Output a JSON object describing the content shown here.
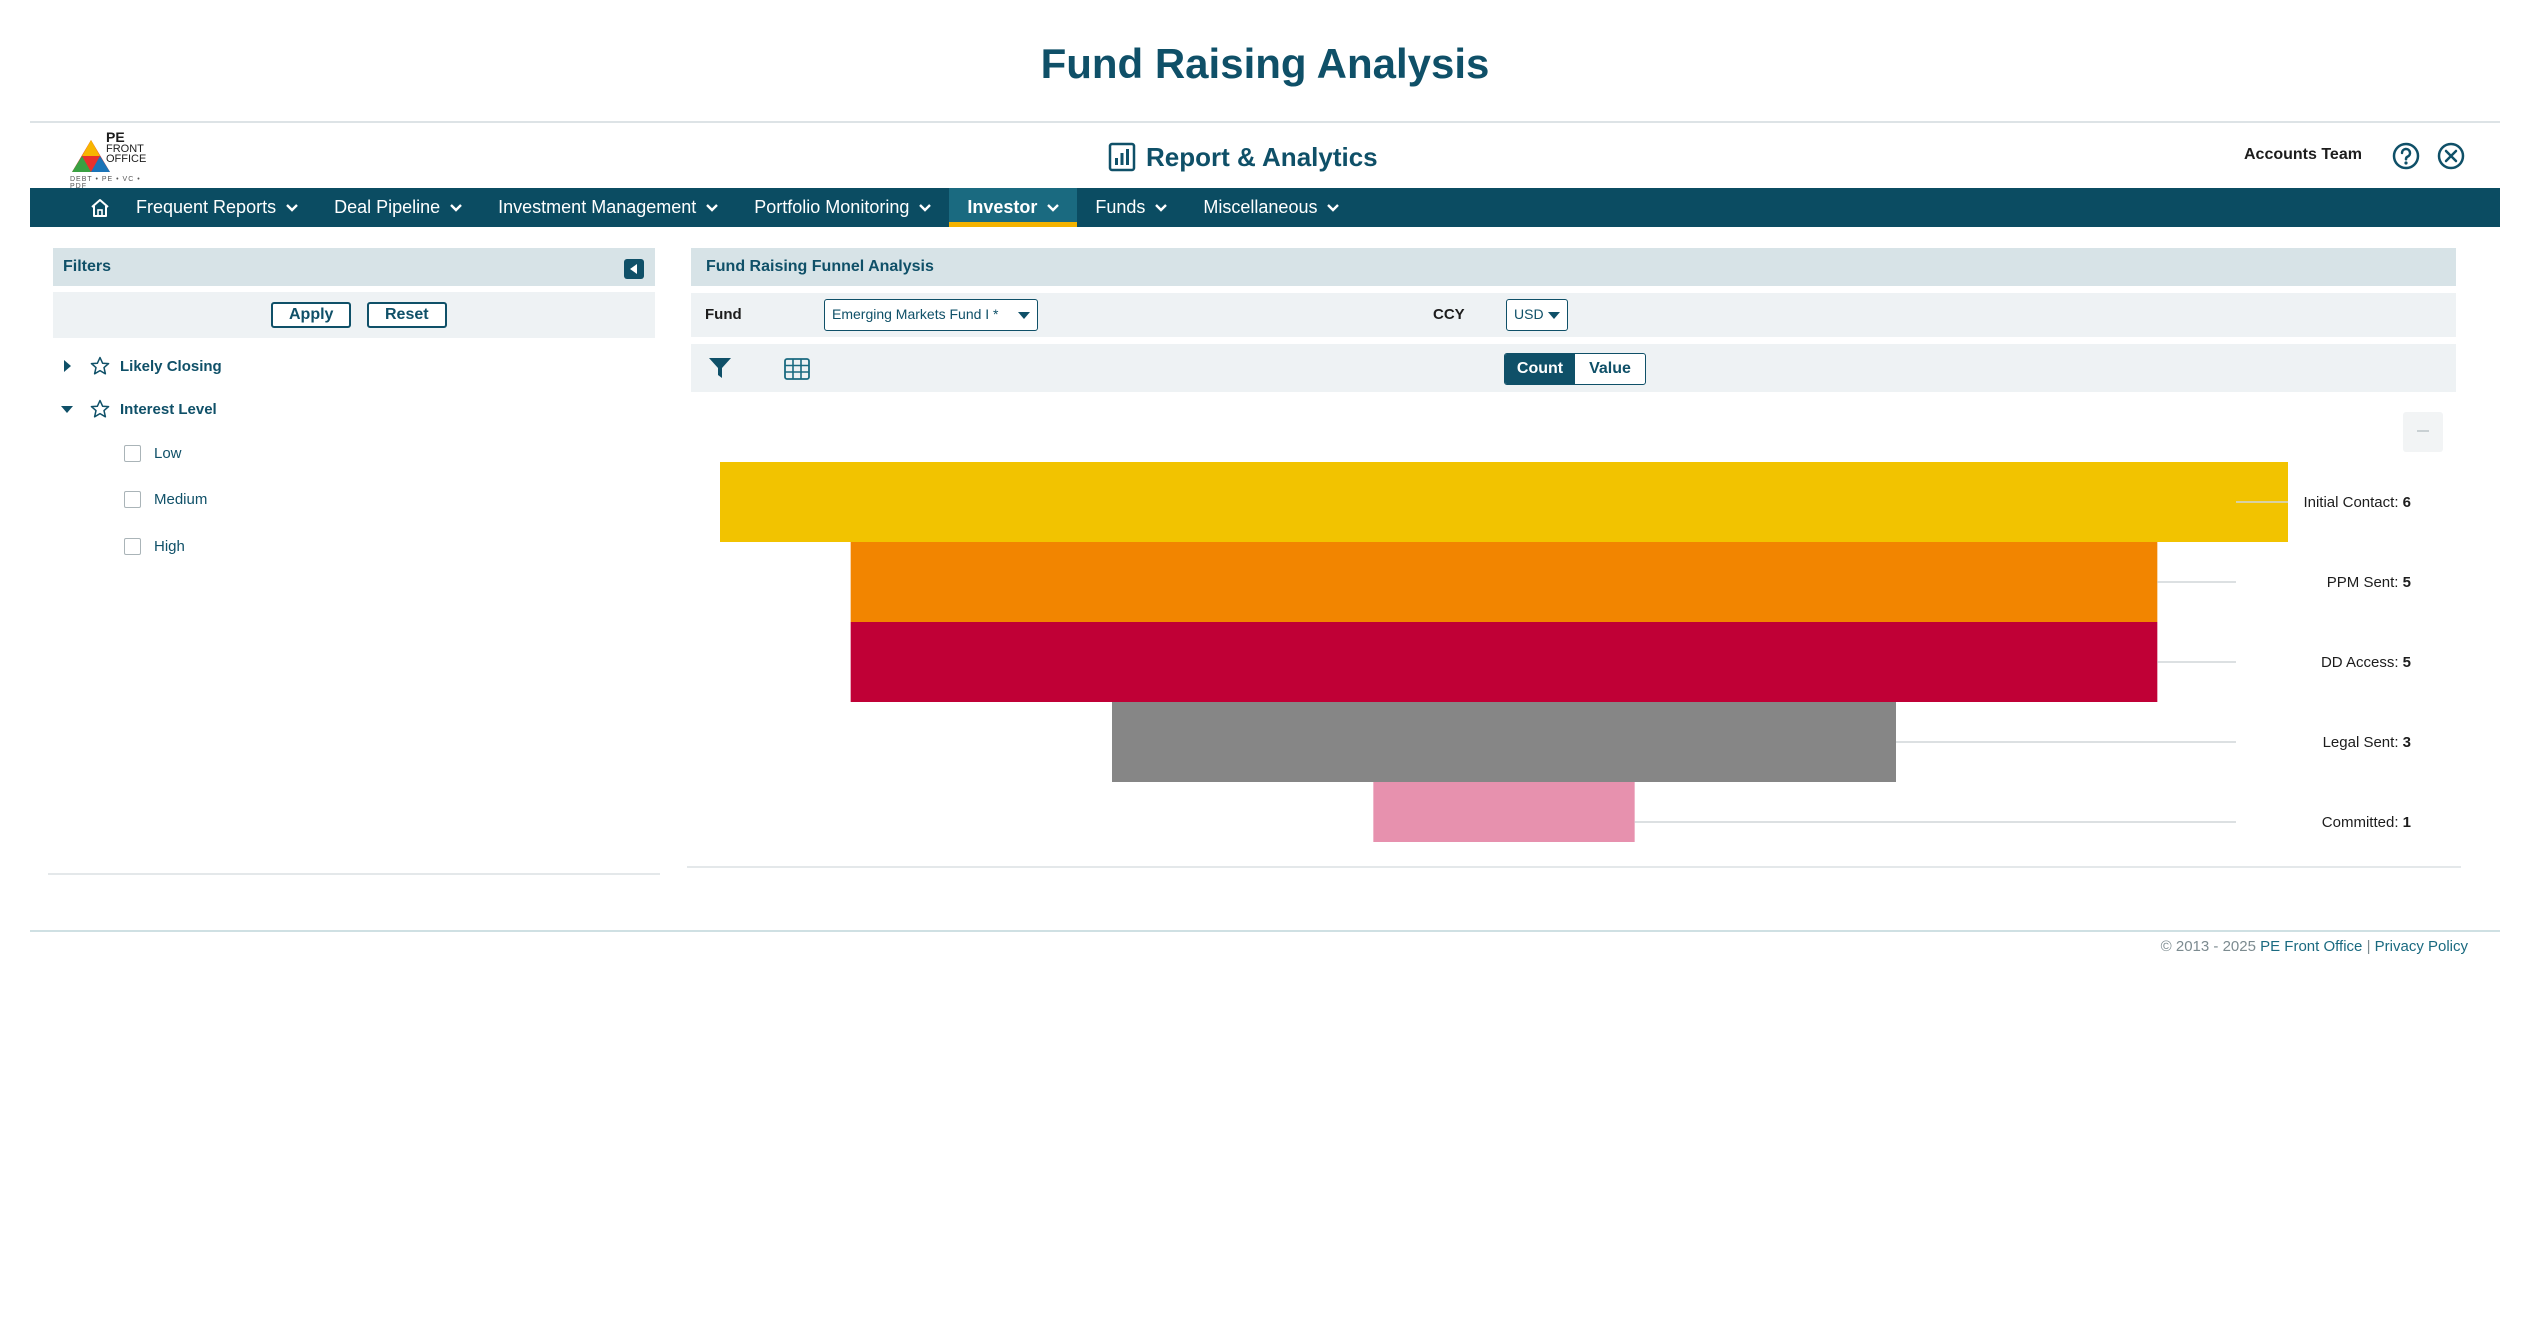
{
  "page": {
    "title": "Fund Raising Analysis"
  },
  "header": {
    "logo_top": "PE",
    "logo_mid": "FRONT",
    "logo_bottom": "OFFICE",
    "logo_sub": "DEBT • PE • VC • PDF",
    "app_title": "Report & Analytics",
    "user": "Accounts Team"
  },
  "nav": {
    "items": [
      {
        "label": "Frequent Reports"
      },
      {
        "label": "Deal Pipeline"
      },
      {
        "label": "Investment Management"
      },
      {
        "label": "Portfolio Monitoring"
      },
      {
        "label": "Investor",
        "active": true
      },
      {
        "label": "Funds"
      },
      {
        "label": "Miscellaneous"
      }
    ]
  },
  "filters": {
    "title": "Filters",
    "apply": "Apply",
    "reset": "Reset",
    "groups": [
      {
        "label": "Likely Closing",
        "expanded": false
      },
      {
        "label": "Interest Level",
        "expanded": true
      }
    ],
    "options": [
      "Low",
      "Medium",
      "High"
    ]
  },
  "funnel": {
    "title": "Fund Raising Funnel Analysis",
    "fund_label": "Fund",
    "fund_value": "Emerging Markets Fund I *",
    "ccy_label": "CCY",
    "ccy_value": "USD",
    "toggle": {
      "count": "Count",
      "value": "Value",
      "selected": "Count"
    }
  },
  "chart_data": {
    "type": "funnel",
    "categories": [
      "Initial Contact",
      "PPM Sent",
      "DD Access",
      "Legal Sent",
      "Committed"
    ],
    "values": [
      6,
      5,
      5,
      3,
      1
    ],
    "colors": [
      "#f2c300",
      "#f28500",
      "#c00036",
      "#868686",
      "#e791ae"
    ]
  },
  "footer": {
    "copyright": "© 2013 - 2025",
    "company": "PE Front Office",
    "separator": "|",
    "privacy": "Privacy Policy"
  }
}
